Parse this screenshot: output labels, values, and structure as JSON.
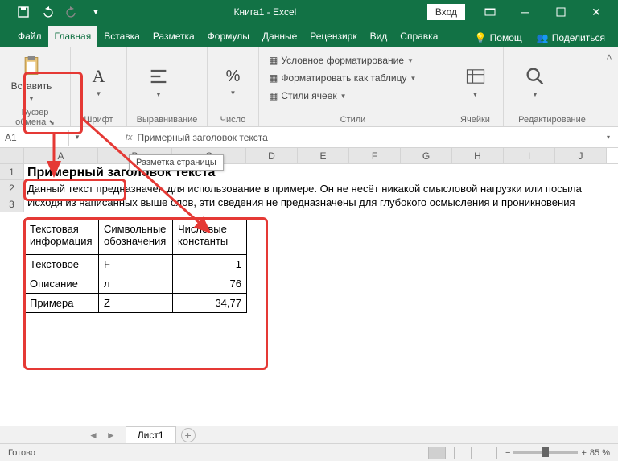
{
  "title": {
    "left": "Книга1",
    "sep": " - ",
    "right": "Excel"
  },
  "signin": "Вход",
  "tabs": [
    "Файл",
    "Главная",
    "Вставка",
    "Разметка",
    "Формулы",
    "Данные",
    "Рецензирк",
    "Вид",
    "Справка"
  ],
  "active_tab": 1,
  "help_icon": "Помощ",
  "share": "Поделиться",
  "ribbon": {
    "paste": "Вставить",
    "clipboard": "Буфер обмена",
    "font": "Шрифт",
    "alignment": "Выравнивание",
    "number_sym": "%",
    "number": "Число",
    "cond_fmt": "Условное форматирование",
    "fmt_table": "Форматировать как таблицу",
    "cell_styles": "Стили ячеек",
    "styles": "Стили",
    "cells": "Ячейки",
    "editing": "Редактирование"
  },
  "tooltip": "Разметка страницы",
  "namebox": "A1",
  "formula": "Примерный заголовок текста",
  "columns": [
    "A",
    "B",
    "C",
    "D",
    "E",
    "F",
    "G",
    "H",
    "I",
    "J"
  ],
  "heading": "Примерный заголовок текста",
  "line2": "Данный текст предназначен для использование в примере. Он не несёт никакой смысловой нагрузки или посыла",
  "line3": "Исходя из написанных выше слов, эти сведения не предназначены для глубокого осмысления и проникновения",
  "table": {
    "headers": [
      "Текстовая информация",
      "Символьные обозначения",
      "Числовые константы"
    ],
    "rows": [
      [
        "Текстовое",
        "F",
        "1"
      ],
      [
        "Описание",
        "л",
        "76"
      ],
      [
        "Примера",
        "Z",
        "34,77"
      ]
    ]
  },
  "sheet_tab": "Лист1",
  "status": "Готово",
  "zoom": "85 %"
}
